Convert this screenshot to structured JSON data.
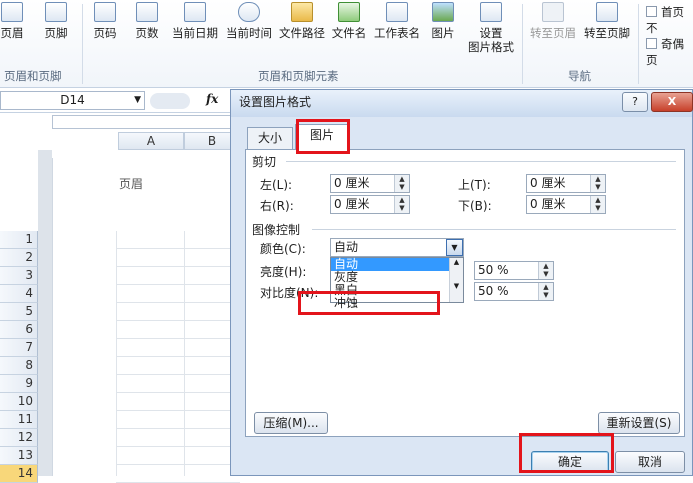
{
  "ribbon": {
    "buttons": [
      {
        "label": "页眉",
        "icon": "header-icon",
        "disabled": false
      },
      {
        "label": "页脚",
        "icon": "footer-icon",
        "disabled": false
      },
      {
        "label": "页码",
        "icon": "page-number-icon",
        "disabled": false
      },
      {
        "label": "页数",
        "icon": "page-count-icon",
        "disabled": false
      },
      {
        "label": "当前日期",
        "icon": "calendar-icon",
        "disabled": false
      },
      {
        "label": "当前时间",
        "icon": "clock-icon",
        "disabled": false
      },
      {
        "label": "文件路径",
        "icon": "folder-icon",
        "disabled": false
      },
      {
        "label": "文件名",
        "icon": "file-icon",
        "disabled": false
      },
      {
        "label": "工作表名",
        "icon": "sheet-icon",
        "disabled": false
      },
      {
        "label": "图片",
        "icon": "picture-icon",
        "disabled": false
      },
      {
        "label": "设置",
        "label2": "图片格式",
        "icon": "format-picture-icon",
        "disabled": false
      },
      {
        "label": "转至页眉",
        "icon": "goto-header-icon",
        "disabled": true
      },
      {
        "label": "转至页脚",
        "icon": "goto-footer-icon",
        "disabled": false
      }
    ],
    "groups": {
      "header_footer": "页眉和页脚",
      "elements": "页眉和页脚元素",
      "navigation": "导航"
    },
    "options": {
      "first_page": "首页不",
      "odd_even": "奇偶页"
    }
  },
  "formula_bar": {
    "name_box": "D14",
    "fx": "fx"
  },
  "sheet": {
    "columns": [
      "A",
      "B"
    ],
    "rows": [
      "1",
      "2",
      "3",
      "4",
      "5",
      "6",
      "7",
      "8",
      "9",
      "10",
      "11",
      "12",
      "13",
      "14"
    ],
    "selected_row": "14",
    "header_text": "页眉"
  },
  "dialog": {
    "title": "设置图片格式",
    "help": "?",
    "close": "X",
    "tabs": [
      "大小",
      "图片"
    ],
    "active_tab": "图片",
    "crop": {
      "section": "剪切",
      "left_label": "左(L):",
      "left_value": "0 厘米",
      "top_label": "上(T):",
      "top_value": "0 厘米",
      "right_label": "右(R):",
      "right_value": "0 厘米",
      "bottom_label": "下(B):",
      "bottom_value": "0 厘米"
    },
    "image_control": {
      "section": "图像控制",
      "color_label": "颜色(C):",
      "color_value": "自动",
      "color_options": [
        "自动",
        "灰度",
        "黑白",
        "冲蚀"
      ],
      "brightness_label": "亮度(H):",
      "brightness_value": "50 %",
      "contrast_label": "对比度(N):",
      "contrast_value": "50 %"
    },
    "compress_label": "压缩(M)...",
    "reset_label": "重新设置(S)",
    "ok_label": "确定",
    "cancel_label": "取消"
  }
}
